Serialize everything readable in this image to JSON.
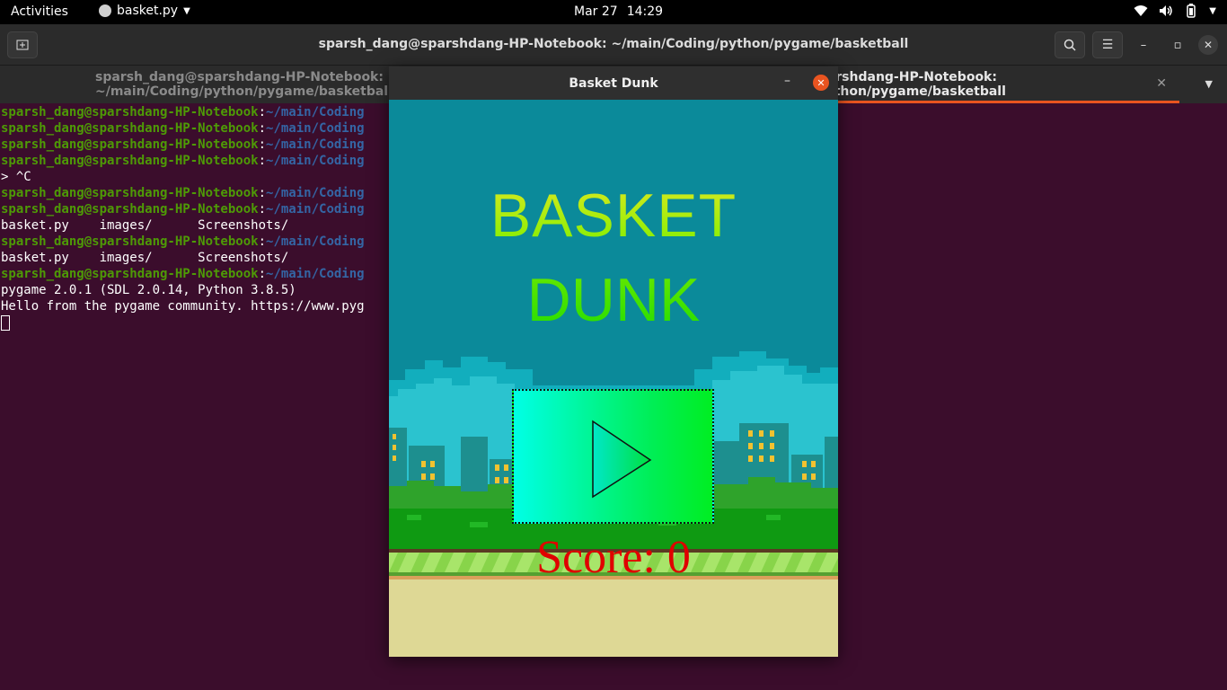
{
  "topbar": {
    "activities": "Activities",
    "app_name": "basket.py",
    "date": "Mar 27",
    "time": "14:29"
  },
  "terminal_window": {
    "title": "sparsh_dang@sparshdang-HP-Notebook: ~/main/Coding/python/pygame/basketball",
    "tabs": [
      {
        "label": "sparsh_dang@sparshdang-HP-Notebook: ~/main/Coding/python/pygame/basketball",
        "active": false
      },
      {
        "label": "sparsh_dang@sparshdang-HP-Notebook: ~/main/Coding/python/pygame/basketball",
        "active": true
      }
    ],
    "lines": [
      {
        "user": "sparsh_dang@sparshdang-HP-Notebook",
        "path": "~/main/Coding"
      },
      {
        "user": "sparsh_dang@sparshdang-HP-Notebook",
        "path": "~/main/Coding"
      },
      {
        "user": "sparsh_dang@sparshdang-HP-Notebook",
        "path": "~/main/Coding"
      },
      {
        "user": "sparsh_dang@sparshdang-HP-Notebook",
        "path": "~/main/Coding"
      },
      {
        "text": "> ^C"
      },
      {
        "user": "sparsh_dang@sparshdang-HP-Notebook",
        "path": "~/main/Coding"
      },
      {
        "user": "sparsh_dang@sparshdang-HP-Notebook",
        "path": "~/main/Coding"
      },
      {
        "text": "basket.py    images/      Screenshots/"
      },
      {
        "user": "sparsh_dang@sparshdang-HP-Notebook",
        "path": "~/main/Coding"
      },
      {
        "text": "basket.py    images/      Screenshots/"
      },
      {
        "user": "sparsh_dang@sparshdang-HP-Notebook",
        "path": "~/main/Coding"
      },
      {
        "text": "pygame 2.0.1 (SDL 2.0.14, Python 3.8.5)"
      },
      {
        "text": "Hello from the pygame community. https://www.pyg"
      }
    ]
  },
  "game_window": {
    "title": "Basket Dunk",
    "title_line1": "BASKET",
    "title_line2": "DUNK",
    "score_label": "Score: 0",
    "play_icon": "play-triangle-icon"
  },
  "colors": {
    "terminal_bg": "#3b0d2c",
    "prompt_user": "#4e9a06",
    "prompt_path": "#3465a4",
    "accent": "#e95420",
    "sky": "#0b8a9a",
    "score": "#e00000"
  }
}
